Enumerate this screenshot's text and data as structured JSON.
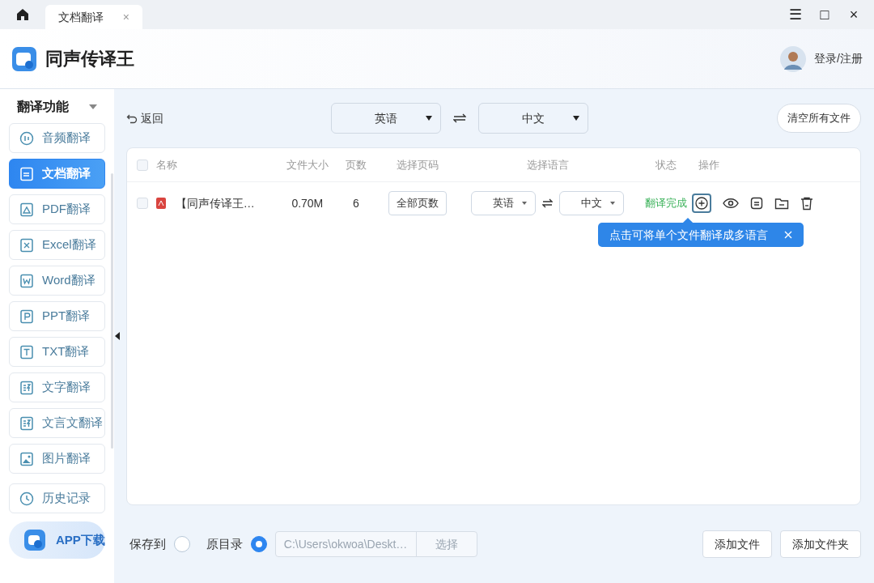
{
  "tab": {
    "label": "文档翻译",
    "close": "×"
  },
  "window_controls": [
    "☰",
    "□",
    "×"
  ],
  "app": {
    "title": "同声传译王",
    "login": "登录/注册"
  },
  "sidebar": {
    "heading": "翻译功能",
    "items": [
      {
        "label": "音频翻译",
        "kind": "audio",
        "selected": false
      },
      {
        "label": "文档翻译",
        "kind": "doc",
        "selected": true
      },
      {
        "label": "PDF翻译",
        "kind": "pdf",
        "selected": false
      },
      {
        "label": "Excel翻译",
        "kind": "excel",
        "selected": false
      },
      {
        "label": "Word翻译",
        "kind": "word",
        "selected": false
      },
      {
        "label": "PPT翻译",
        "kind": "ppt",
        "selected": false
      },
      {
        "label": "TXT翻译",
        "kind": "txt",
        "selected": false
      },
      {
        "label": "文字翻译",
        "kind": "text",
        "selected": false
      },
      {
        "label": "文言文翻译",
        "kind": "text",
        "selected": false
      },
      {
        "label": "图片翻译",
        "kind": "image",
        "selected": false
      }
    ],
    "history": "历史记录",
    "app_download": "APP下载"
  },
  "toolbar": {
    "back": "返回",
    "source_lang": "英语",
    "target_lang": "中文",
    "clear": "清空所有文件"
  },
  "table": {
    "all_checked": false,
    "columns": [
      "名称",
      "文件大小",
      "页数",
      "选择页码",
      "选择语言",
      "状态",
      "操作"
    ],
    "rows": [
      {
        "checked": false,
        "name": "【同声传译王…",
        "size": "0.70M",
        "pages": "6",
        "page_range": "全部页数",
        "source": "英语",
        "target": "中文",
        "status": "翻译完成"
      }
    ],
    "tooltip": "点击可将单个文件翻译成多语言"
  },
  "footer": {
    "save_to": "保存到",
    "options": [
      {
        "label": "原目录",
        "selected": true
      }
    ],
    "save_to_selected": false,
    "path": "C:\\Users\\okwoa\\Deskt…",
    "choose": "选择",
    "buttons": [
      "添加文件",
      "添加文件夹"
    ]
  }
}
